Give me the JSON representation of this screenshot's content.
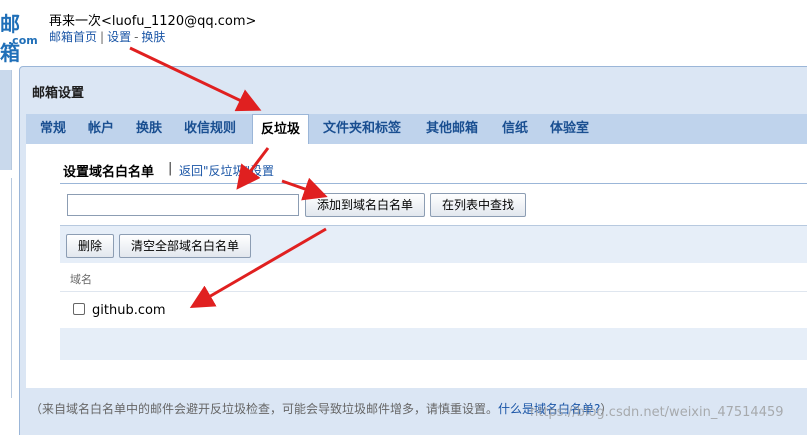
{
  "header": {
    "logo_main": "邮箱",
    "logo_sub": ".com",
    "greeting": "再来一次<luofu_1120@qq.com>",
    "links": {
      "home": "邮箱首页",
      "settings": "设置",
      "skin": "换肤"
    },
    "sep1": "|",
    "sep2": "-"
  },
  "settings": {
    "title": "邮箱设置",
    "tabs": [
      "常规",
      "帐户",
      "换肤",
      "收信规则",
      "反垃圾",
      "文件夹和标签",
      "其他邮箱",
      "信纸",
      "体验室"
    ],
    "active_tab": "反垃圾"
  },
  "whitelist": {
    "section_title": "设置域名白名单",
    "separator": "|",
    "back_link": "返回\"反垃圾\"设置",
    "input_value": "",
    "add_button": "添加到域名白名单",
    "find_button": "在列表中查找",
    "delete_button": "删除",
    "clear_button": "清空全部域名白名单",
    "column_header": "域名",
    "entries": [
      "github.com"
    ]
  },
  "footer": {
    "note": "（来自域名白名单中的邮件会避开反垃圾检查，可能会导致垃圾邮件增多，请慎重设置。",
    "help_link": "什么是域名白名单?",
    "note_end": "）",
    "watermark": "https://blog.csdn.net/weixin_47514459"
  },
  "colors": {
    "accent": "#1a55a6",
    "tab_text": "#1a4f91",
    "panel": "#dbe6f4",
    "arrow": "#e02020"
  }
}
